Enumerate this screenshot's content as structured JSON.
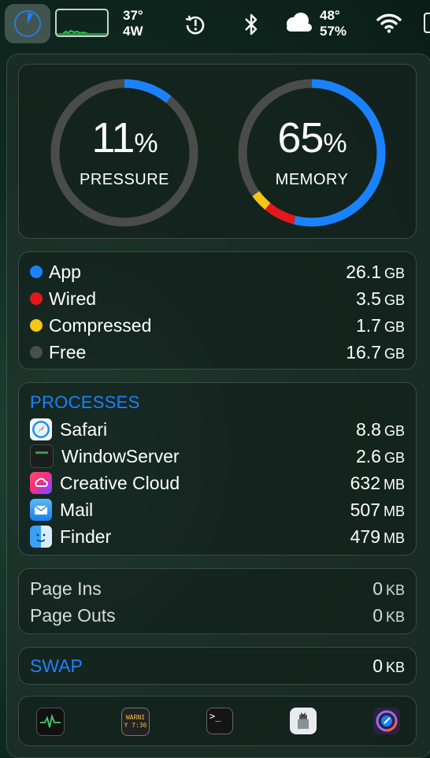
{
  "menubar": {
    "temp": "37°",
    "power": "4W",
    "weather_temp": "48°",
    "weather_humidity": "57%"
  },
  "gauges": {
    "pressure": {
      "value": "11",
      "pct_symbol": "%",
      "label": "PRESSURE",
      "fraction": 0.11,
      "color": "#1a82ff"
    },
    "memory": {
      "value": "65",
      "pct_symbol": "%",
      "label": "MEMORY",
      "segments": [
        {
          "name": "App",
          "fraction": 0.54,
          "color": "#1a82ff"
        },
        {
          "name": "Wired",
          "fraction": 0.07,
          "color": "#e5161c"
        },
        {
          "name": "Compressed",
          "fraction": 0.04,
          "color": "#f5c518"
        }
      ]
    }
  },
  "memory_breakdown": [
    {
      "label": "App",
      "value": "26.1",
      "unit": "GB",
      "color": "#1a82ff"
    },
    {
      "label": "Wired",
      "value": "3.5",
      "unit": "GB",
      "color": "#e5161c"
    },
    {
      "label": "Compressed",
      "value": "1.7",
      "unit": "GB",
      "color": "#f5c518"
    },
    {
      "label": "Free",
      "value": "16.7",
      "unit": "GB",
      "color": "#4a4f4d"
    }
  ],
  "processes": {
    "heading": "PROCESSES",
    "items": [
      {
        "name": "Safari",
        "value": "8.8",
        "unit": "GB",
        "icon": "safari-icon"
      },
      {
        "name": "WindowServer",
        "value": "2.6",
        "unit": "GB",
        "icon": "windowserver-icon"
      },
      {
        "name": "Creative Cloud",
        "value": "632",
        "unit": "MB",
        "icon": "creative-cloud-icon"
      },
      {
        "name": "Mail",
        "value": "507",
        "unit": "MB",
        "icon": "mail-icon"
      },
      {
        "name": "Finder",
        "value": "479",
        "unit": "MB",
        "icon": "finder-icon"
      }
    ]
  },
  "paging": [
    {
      "label": "Page Ins",
      "value": "0",
      "unit": "KB"
    },
    {
      "label": "Page Outs",
      "value": "0",
      "unit": "KB"
    }
  ],
  "swap": {
    "heading": "SWAP",
    "value": "0",
    "unit": "KB"
  },
  "dock": [
    {
      "icon": "activity-monitor-icon"
    },
    {
      "icon": "console-icon",
      "text_line1": "WARNI",
      "text_line2": "Y 7:36"
    },
    {
      "icon": "terminal-icon",
      "text": ">_"
    },
    {
      "icon": "system-info-icon"
    },
    {
      "icon": "disk-utility-icon"
    }
  ]
}
